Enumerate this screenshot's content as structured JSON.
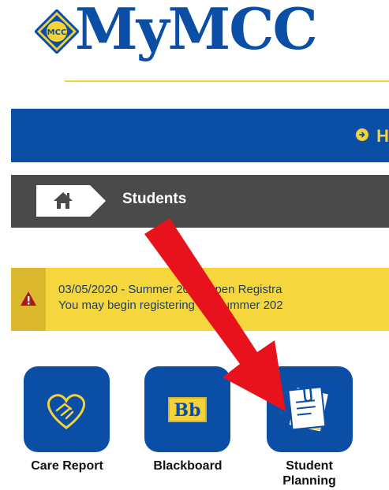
{
  "brand": {
    "logo_text": "MyMCC",
    "logo_initials": "MCC",
    "blue": "#0a4ea6",
    "gold": "#f3d23a"
  },
  "header": {
    "nav_link_label": "H",
    "nav_link_icon": "arrow-circle-right-icon"
  },
  "breadcrumb": {
    "home_icon": "home-icon",
    "current": "Students"
  },
  "alert": {
    "icon": "warning-triangle-icon",
    "line1": "03/05/2020 - Summer 2020 Open Registra",
    "line2": "You may begin registering for Summer 202",
    "background": "#f5d63c",
    "text_color": "#1e3d72"
  },
  "tiles": [
    {
      "label": "Care Report",
      "icon": "heart-handshake-icon"
    },
    {
      "label": "Blackboard",
      "icon": "blackboard-bb-icon",
      "icon_text": "Bb"
    },
    {
      "label": "Student Planning",
      "label_lines": [
        "Student",
        "Planning"
      ],
      "icon": "paper-clipboard-icon"
    }
  ],
  "annotation": {
    "icon": "red-arrow-icon",
    "color": "#e8121c"
  }
}
